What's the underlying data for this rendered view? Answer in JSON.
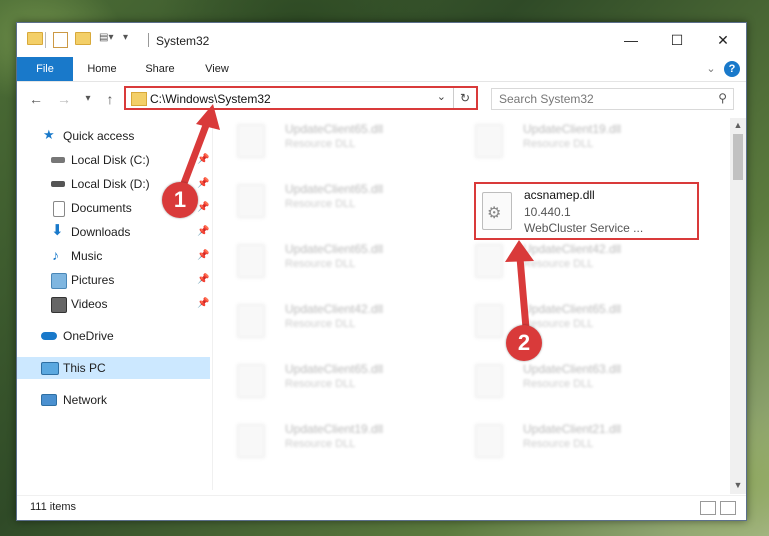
{
  "window": {
    "title": "System32"
  },
  "ribbon": {
    "tabs": [
      "File",
      "Home",
      "Share",
      "View"
    ]
  },
  "address": {
    "path": "C:\\Windows\\System32"
  },
  "search": {
    "placeholder": "Search System32"
  },
  "sidebar": {
    "items": [
      {
        "label": "Quick access",
        "icon": "star-icon",
        "pinned": false
      },
      {
        "label": "Local Disk (C:)",
        "icon": "drive-icon",
        "pinned": true
      },
      {
        "label": "Local Disk (D:)",
        "icon": "drive-icon",
        "pinned": true
      },
      {
        "label": "Documents",
        "icon": "documents-icon",
        "pinned": true
      },
      {
        "label": "Downloads",
        "icon": "downloads-icon",
        "pinned": true
      },
      {
        "label": "Music",
        "icon": "music-icon",
        "pinned": true
      },
      {
        "label": "Pictures",
        "icon": "pictures-icon",
        "pinned": true
      },
      {
        "label": "Videos",
        "icon": "videos-icon",
        "pinned": true
      },
      {
        "label": "OneDrive",
        "icon": "cloud-icon",
        "pinned": false
      },
      {
        "label": "This PC",
        "icon": "computer-icon",
        "pinned": false,
        "selected": true
      },
      {
        "label": "Network",
        "icon": "network-icon",
        "pinned": false
      }
    ]
  },
  "files": {
    "left": [
      {
        "name": "UpdateClient65.dll",
        "desc": "Resource DLL"
      },
      {
        "name": "UpdateClient65.dll",
        "desc": "Resource DLL"
      },
      {
        "name": "UpdateClient65.dll",
        "desc": "Resource DLL"
      },
      {
        "name": "UpdateClient42.dll",
        "desc": "Resource DLL"
      },
      {
        "name": "UpdateClient65.dll",
        "desc": "Resource DLL"
      },
      {
        "name": "UpdateClient19.dll",
        "desc": "Resource DLL"
      }
    ],
    "right": [
      {
        "name": "UpdateClient19.dll",
        "desc": "Resource DLL"
      },
      {
        "name": "UpdateClient42.dll",
        "desc": "Resource DLL"
      },
      {
        "name": "UpdateClient65.dll",
        "desc": "Resource DLL"
      },
      {
        "name": "UpdateClient63.dll",
        "desc": "Resource DLL"
      },
      {
        "name": "UpdateClient21.dll",
        "desc": "Resource DLL"
      }
    ],
    "highlighted": {
      "name": "acsnamep.dll",
      "version": "10.440.1",
      "desc": "WebCluster Service ..."
    }
  },
  "status": {
    "count": "111 items"
  },
  "annotations": {
    "step1": "1",
    "step2": "2"
  },
  "colors": {
    "accent": "#1979ca",
    "highlight": "#d93a3a",
    "selected": "#cce8ff"
  }
}
